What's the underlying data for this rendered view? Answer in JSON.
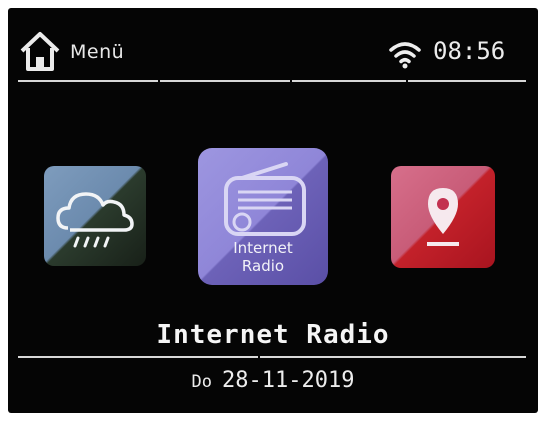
{
  "header": {
    "menu_label": "Menü",
    "time": "08:56"
  },
  "tiles": [
    {
      "id": "weather",
      "icon": "weather-cloud-rain-icon"
    },
    {
      "id": "internet-radio",
      "icon": "radio-icon",
      "caption_line1": "Internet",
      "caption_line2": "Radio"
    },
    {
      "id": "location",
      "icon": "map-pin-icon"
    }
  ],
  "selected": {
    "label": "Internet Radio"
  },
  "footer": {
    "day": "Do",
    "date": "28-11-2019"
  },
  "colors": {
    "screen_bg": "#050505",
    "weather_tile": "#7e9cbd",
    "radio_tile": "#9d96e0",
    "map_tile": "#c3212a",
    "text": "#f0f0f0"
  }
}
